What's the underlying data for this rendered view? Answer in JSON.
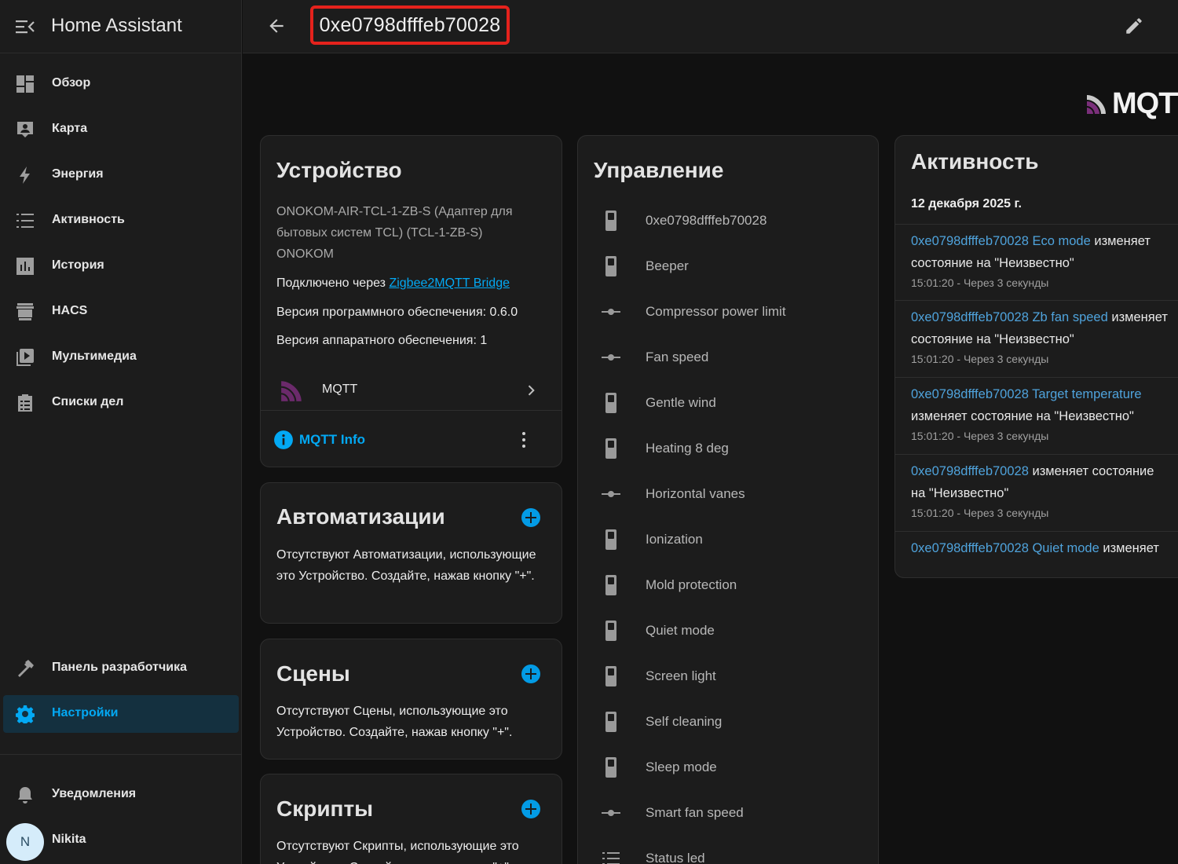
{
  "app": {
    "title": "Home Assistant"
  },
  "sidebar": {
    "items": [
      {
        "label": "Обзор",
        "icon": "dashboard-icon"
      },
      {
        "label": "Карта",
        "icon": "map-icon"
      },
      {
        "label": "Энергия",
        "icon": "lightning-icon"
      },
      {
        "label": "Активность",
        "icon": "list-icon"
      },
      {
        "label": "История",
        "icon": "chart-icon"
      },
      {
        "label": "HACS",
        "icon": "hacs-icon"
      },
      {
        "label": "Мультимедиа",
        "icon": "media-icon"
      },
      {
        "label": "Списки дел",
        "icon": "clipboard-list-icon"
      }
    ],
    "developer": {
      "label": "Панель разработчика",
      "icon": "hammer-icon"
    },
    "settings": {
      "label": "Настройки",
      "icon": "gear-icon"
    },
    "notifications": {
      "label": "Уведомления",
      "icon": "bell-icon"
    },
    "user": {
      "initial": "N",
      "name": "Nikita"
    }
  },
  "header": {
    "title": "0xe0798dfffeb70028"
  },
  "logo": {
    "text": "MQTT"
  },
  "device_card": {
    "heading": "Устройство",
    "model": "ONOKOM-AIR-TCL-1-ZB-S (Адаптер для бытовых систем TCL) (TCL-1-ZB-S)",
    "manufacturer": "ONOKOM",
    "via_prefix": "Подключено через",
    "via_link": "Zigbee2MQTT Bridge",
    "sw_version": "Версия программного обеспечения: 0.6.0",
    "hw_version": "Версия аппаратного обеспечения: 1",
    "integration": "MQTT",
    "info_button": "MQTT Info"
  },
  "automations_card": {
    "heading": "Автоматизации",
    "text": "Отсутствуют Автоматизации, использующие это Устройство. Создайте, нажав кнопку \"+\"."
  },
  "scenes_card": {
    "heading": "Сцены",
    "text": "Отсутствуют Сцены, использующие это Устройство. Создайте, нажав кнопку \"+\"."
  },
  "scripts_card": {
    "heading": "Скрипты",
    "text": "Отсутствуют Скрипты, использующие это Устройство. Создайте, нажав кнопку \"+\"."
  },
  "controls_card": {
    "heading": "Управление",
    "items": [
      {
        "label": "0xe0798dfffeb70028",
        "icon": "switch-icon"
      },
      {
        "label": "Beeper",
        "icon": "switch-icon"
      },
      {
        "label": "Compressor power limit",
        "icon": "select-icon"
      },
      {
        "label": "Fan speed",
        "icon": "select-icon"
      },
      {
        "label": "Gentle wind",
        "icon": "switch-icon"
      },
      {
        "label": "Heating 8 deg",
        "icon": "switch-icon"
      },
      {
        "label": "Horizontal vanes",
        "icon": "select-icon"
      },
      {
        "label": "Ionization",
        "icon": "switch-icon"
      },
      {
        "label": "Mold protection",
        "icon": "switch-icon"
      },
      {
        "label": "Quiet mode",
        "icon": "switch-icon"
      },
      {
        "label": "Screen light",
        "icon": "switch-icon"
      },
      {
        "label": "Self cleaning",
        "icon": "switch-icon"
      },
      {
        "label": "Sleep mode",
        "icon": "switch-icon"
      },
      {
        "label": "Smart fan speed",
        "icon": "select-icon"
      },
      {
        "label": "Status led",
        "icon": "list-icon"
      }
    ]
  },
  "activity_card": {
    "heading": "Активность",
    "date": "12 декабря 2025 г.",
    "entries": [
      {
        "entity": "0xe0798dfffeb70028 Eco mode",
        "action": " изменяет",
        "line2": "состояние на \"Неизвестно\"",
        "time": "15:01:20 - Через 3 секунды"
      },
      {
        "entity": "0xe0798dfffeb70028 Zb fan speed",
        "action": " изменяет",
        "line2": "состояние на \"Неизвестно\"",
        "time": "15:01:20 - Через 3 секунды"
      },
      {
        "entity": "0xe0798dfffeb70028 Target temperature",
        "action": "",
        "line2": "изменяет состояние на \"Неизвестно\"",
        "time": "15:01:20 - Через 3 секунды"
      },
      {
        "entity": "0xe0798dfffeb70028",
        "action": " изменяет состояние",
        "line2": "на \"Неизвестно\"",
        "time": "15:01:20 - Через 3 секунды"
      },
      {
        "entity": "0xe0798dfffeb70028 Quiet mode",
        "action": " изменяет",
        "line2": "",
        "time": ""
      }
    ]
  },
  "colors": {
    "accent": "#03a9f4",
    "highlight_border": "#e5221c",
    "background": "#111111",
    "card": "#1c1c1c"
  }
}
